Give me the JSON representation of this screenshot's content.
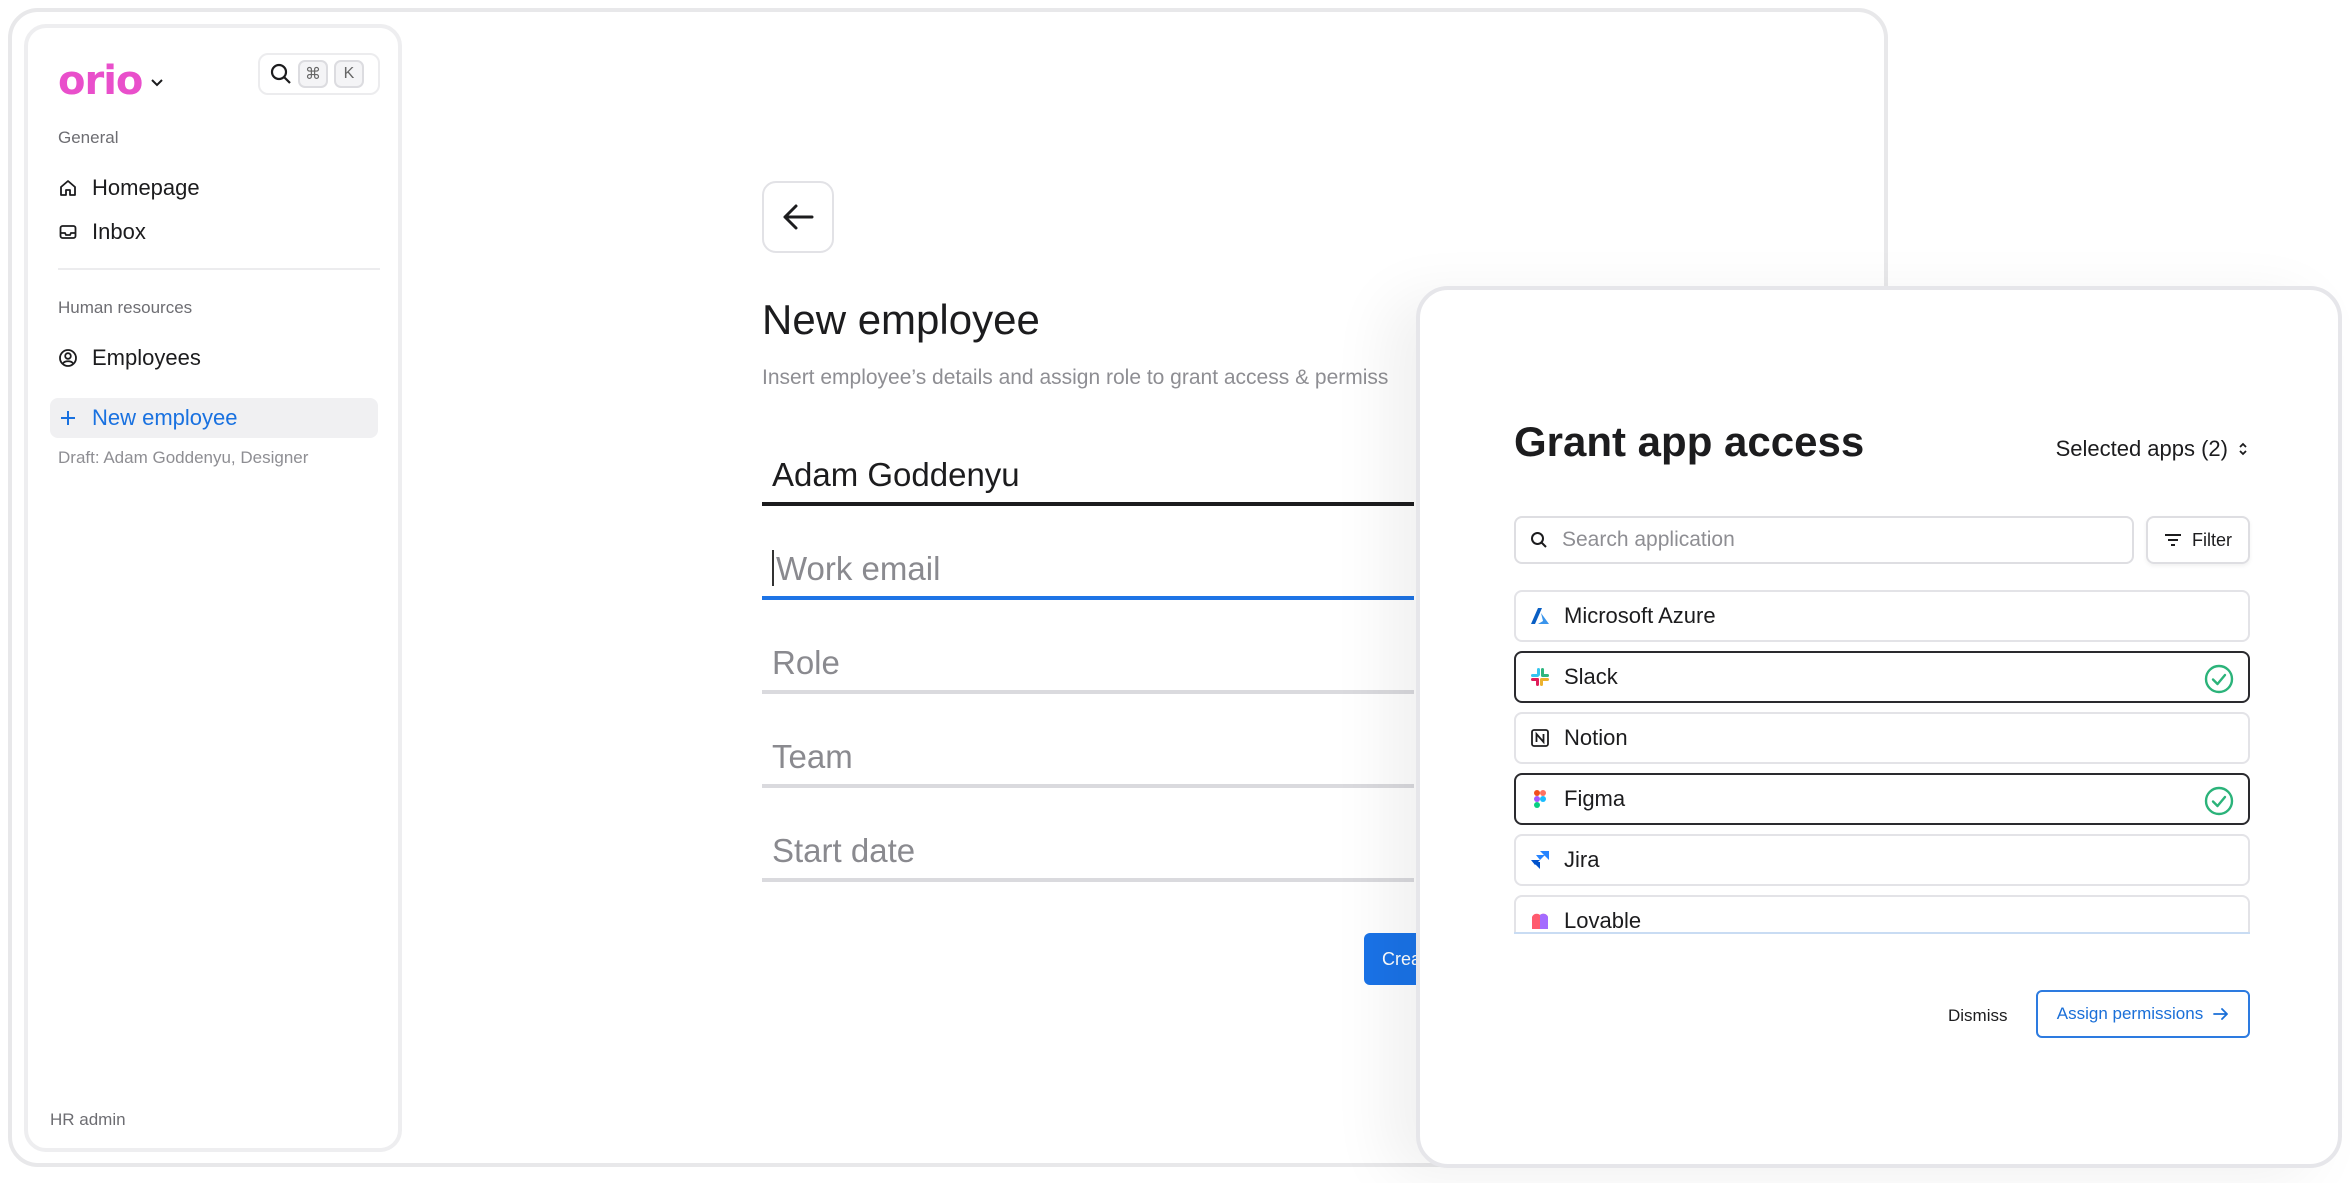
{
  "sidebar": {
    "logo": "orio",
    "shortcut_keys": [
      "⌘",
      "K"
    ],
    "sections": [
      {
        "label": "General",
        "items": [
          {
            "label": "Homepage",
            "icon": "home-icon"
          },
          {
            "label": "Inbox",
            "icon": "inbox-icon"
          }
        ]
      },
      {
        "label": "Human resources",
        "items": [
          {
            "label": "Employees",
            "icon": "user-circle-icon"
          }
        ]
      }
    ],
    "active_item": {
      "label": "New employee",
      "icon": "plus-icon"
    },
    "draft": "Draft: Adam Goddenyu, Designer",
    "footer": "HR admin"
  },
  "form": {
    "title": "New employee",
    "subtitle": "Insert employee’s details and assign role to grant access & permiss",
    "fields": [
      {
        "value": "Adam Goddenyu",
        "state": "filled"
      },
      {
        "value": "Work email",
        "state": "focused-placeholder"
      },
      {
        "value": "Role",
        "state": "placeholder"
      },
      {
        "value": "Team",
        "state": "placeholder"
      },
      {
        "value": "Start date",
        "state": "placeholder"
      }
    ],
    "create_label": "Crea"
  },
  "modal": {
    "title": "Grant app access",
    "selected_apps": "Selected apps (2)",
    "search_placeholder": "Search application",
    "filter_label": "Filter",
    "apps": [
      {
        "name": "Microsoft Azure",
        "icon": "azure-icon",
        "selected": false
      },
      {
        "name": "Slack",
        "icon": "slack-icon",
        "selected": true
      },
      {
        "name": "Notion",
        "icon": "notion-icon",
        "selected": false
      },
      {
        "name": "Figma",
        "icon": "figma-icon",
        "selected": true
      },
      {
        "name": "Jira",
        "icon": "jira-icon",
        "selected": false
      },
      {
        "name": "Lovable",
        "icon": "lovable-icon",
        "selected": false
      }
    ],
    "dismiss_label": "Dismiss",
    "assign_label": "Assign permissions"
  },
  "colors": {
    "brand": "#e94fcb",
    "accent": "#1a73e8",
    "check": "#2bb37a"
  }
}
